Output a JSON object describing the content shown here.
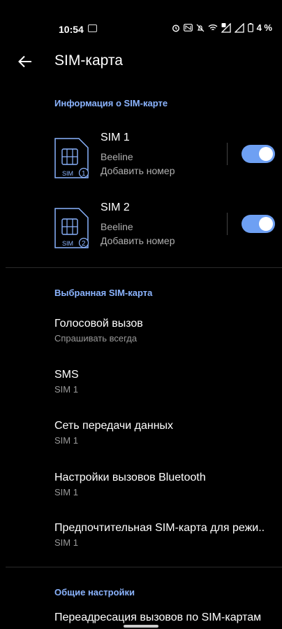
{
  "status_bar": {
    "time": "10:54",
    "battery_text": "4 %"
  },
  "app_bar": {
    "title": "SIM-карта",
    "back_icon": "arrow-left-icon"
  },
  "sim_info": {
    "header": "Информация о SIM-карте",
    "sims": [
      {
        "name": "SIM 1",
        "carrier": "Beeline",
        "add_number": "Добавить номер",
        "icon_label": "SIM",
        "icon_number": "1",
        "enabled": true
      },
      {
        "name": "SIM 2",
        "carrier": "Beeline",
        "add_number": "Добавить номер",
        "icon_label": "SIM",
        "icon_number": "2",
        "enabled": true
      }
    ]
  },
  "preferred_sim": {
    "header": "Выбранная SIM-карта",
    "items": [
      {
        "title": "Голосовой вызов",
        "subtitle": "Спрашивать всегда"
      },
      {
        "title": "SMS",
        "subtitle": "SIM 1"
      },
      {
        "title": "Сеть передачи данных",
        "subtitle": "SIM 1"
      },
      {
        "title": "Настройки вызовов Bluetooth",
        "subtitle": "SIM 1"
      },
      {
        "title": "Предпочтительная SIM-карта для режи..",
        "subtitle": "SIM 1"
      }
    ]
  },
  "general": {
    "header": "Общие настройки",
    "items": [
      {
        "title": "Переадресация вызовов по SIM-картам"
      }
    ]
  },
  "colors": {
    "accent": "#6ea0f3",
    "section_header": "#8bb4ff",
    "background": "#000000"
  }
}
